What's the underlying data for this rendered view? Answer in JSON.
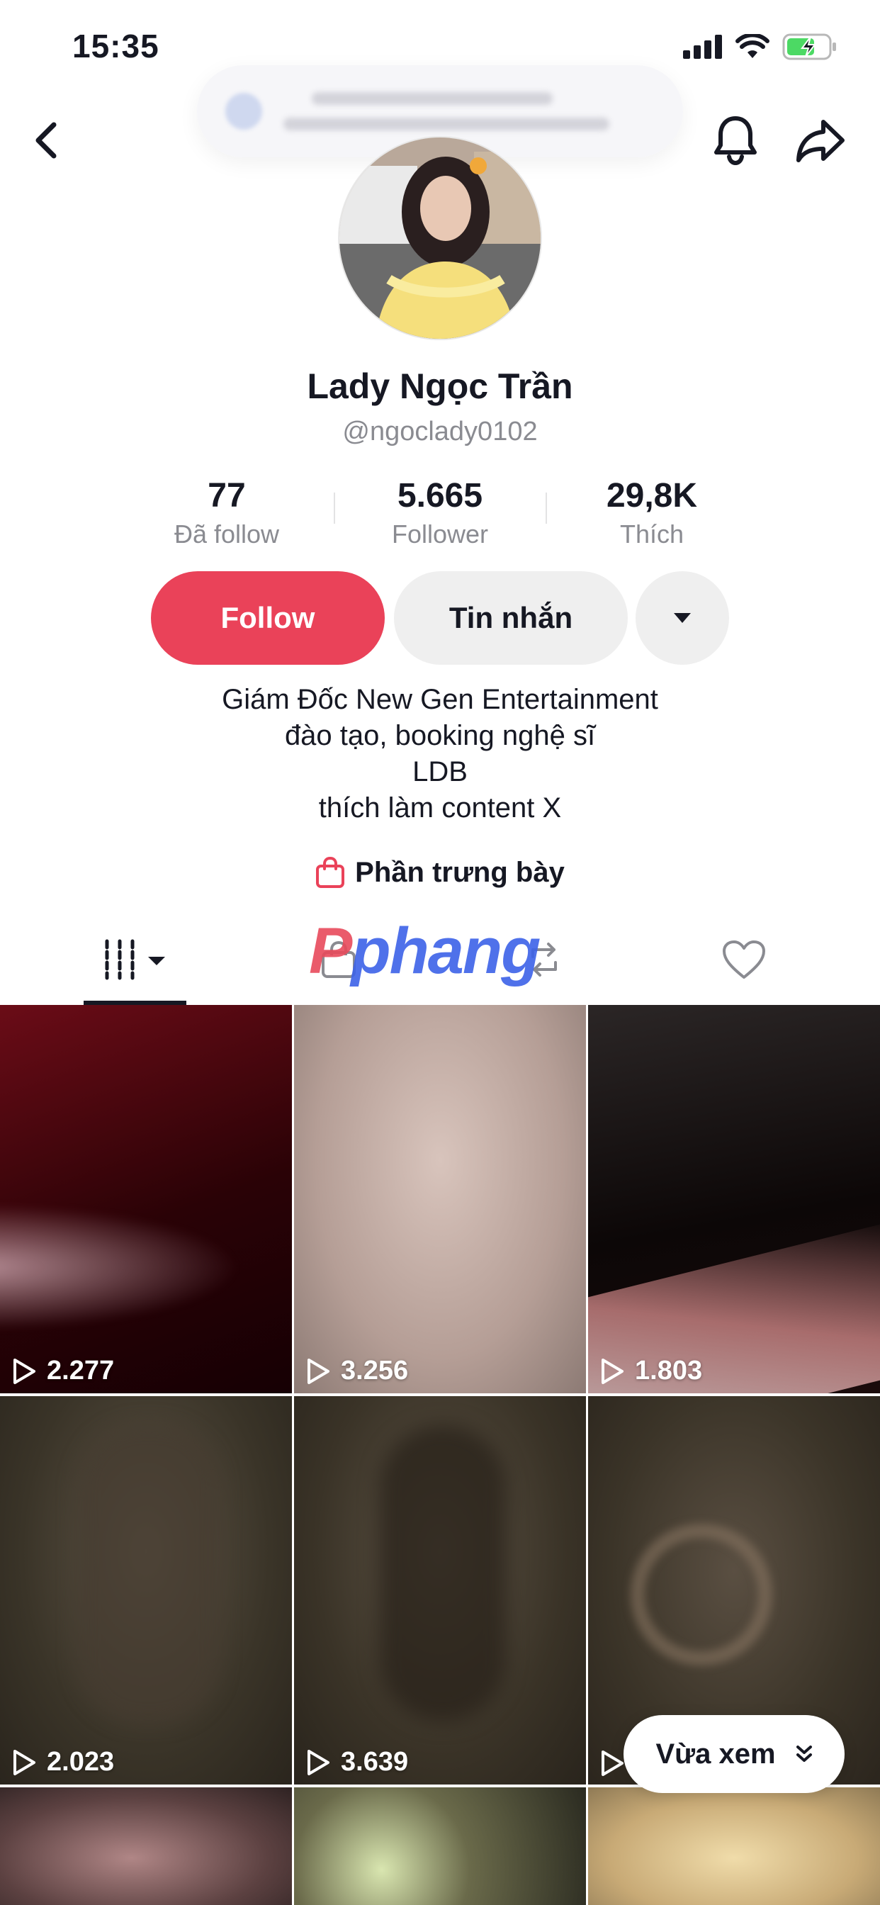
{
  "status_bar": {
    "time": "15:35"
  },
  "profile": {
    "name": "Lady Ngọc Trần",
    "handle": "@ngoclady0102",
    "stats": [
      {
        "value": "77",
        "label": "Đã follow"
      },
      {
        "value": "5.665",
        "label": "Follower"
      },
      {
        "value": "29,8K",
        "label": "Thích"
      }
    ],
    "follow_label": "Follow",
    "message_label": "Tin nhắn",
    "bio_lines": [
      "Giám Đốc New Gen Entertainment",
      "đào tạo, booking nghệ sĩ",
      "LDB",
      "thích làm content X"
    ],
    "showcase_label": "Phần trưng bày"
  },
  "watermark": {
    "first": "P",
    "rest": "phang"
  },
  "videos": [
    {
      "views": "2.277"
    },
    {
      "views": "3.256"
    },
    {
      "views": "1.803"
    },
    {
      "views": "2.023"
    },
    {
      "views": "3.639"
    },
    {
      "views": ""
    }
  ],
  "recent_button_label": "Vừa xem",
  "colors": {
    "follow": "#ea4259",
    "secondary_button": "#efefef",
    "muted_text": "#8a8b91"
  }
}
